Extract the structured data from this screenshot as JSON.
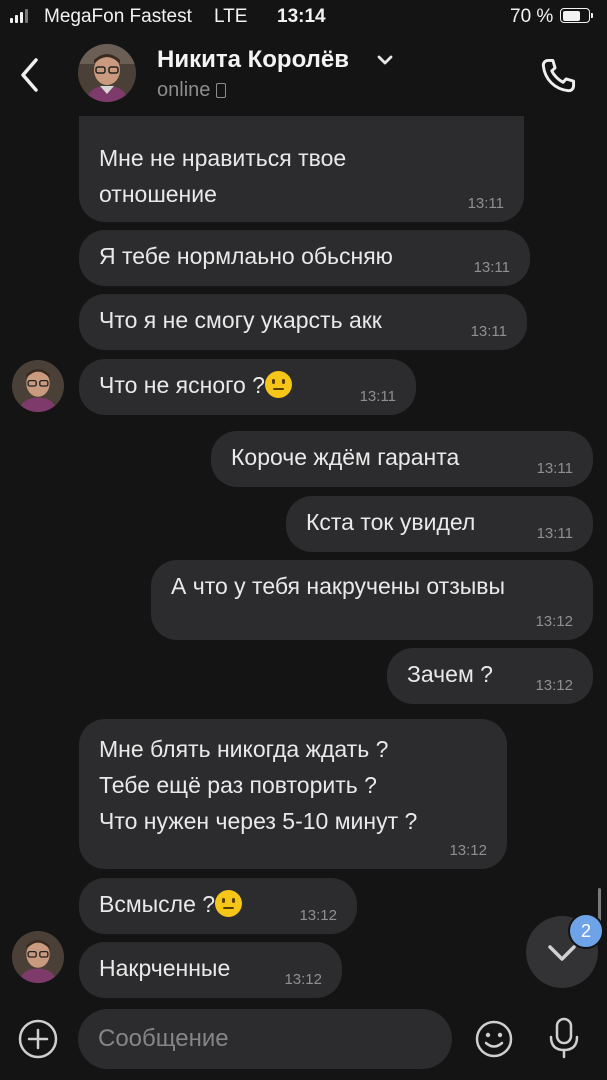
{
  "status_bar": {
    "carrier": "MegaFon Fastest",
    "network": "LTE",
    "time": "13:14",
    "battery": "70 %",
    "battery_level": 0.7
  },
  "header": {
    "name": "Никита Королёв",
    "status": "online"
  },
  "messages": [
    {
      "side": "in",
      "text": "Мне не нравиться твое\nотношение",
      "time": "13:11"
    },
    {
      "side": "in",
      "text": "Я тебе нормлаьно обьсняю",
      "time": "13:11"
    },
    {
      "side": "in",
      "text": "Что я не смогу укарсть акк",
      "time": "13:11"
    },
    {
      "side": "in",
      "text": "Что не ясного ?",
      "emoji": "neutral-face",
      "time": "13:11"
    },
    {
      "side": "out",
      "text": "Короче ждём гаранта",
      "time": "13:11"
    },
    {
      "side": "out",
      "text": "Кста ток увидел",
      "time": "13:11"
    },
    {
      "side": "out",
      "text": "А что у тебя накручены отзывы",
      "time": "13:12"
    },
    {
      "side": "out",
      "text": "Зачем ?",
      "time": "13:12"
    },
    {
      "side": "in",
      "text": "Мне блять никогда ждать ?\nТебе ещё раз повторить ?\nЧто нужен через 5-10 минут ?",
      "time": "13:12"
    },
    {
      "side": "in",
      "text": "Всмысле ?",
      "emoji": "neutral-face",
      "time": "13:12"
    },
    {
      "side": "in",
      "text": "Накрченные",
      "time": "13:12"
    }
  ],
  "unread_badge": "2",
  "composer": {
    "placeholder": "Сообщение"
  },
  "colors": {
    "background": "#141414",
    "bubble": "#2c2c2e",
    "badge": "#6fa3e8",
    "emoji": "#f5c518"
  },
  "icons": [
    "back-arrow-icon",
    "chevron-down-icon",
    "phone-icon",
    "chevron-down-icon",
    "plus-circle-icon",
    "smiley-icon",
    "microphone-icon"
  ]
}
